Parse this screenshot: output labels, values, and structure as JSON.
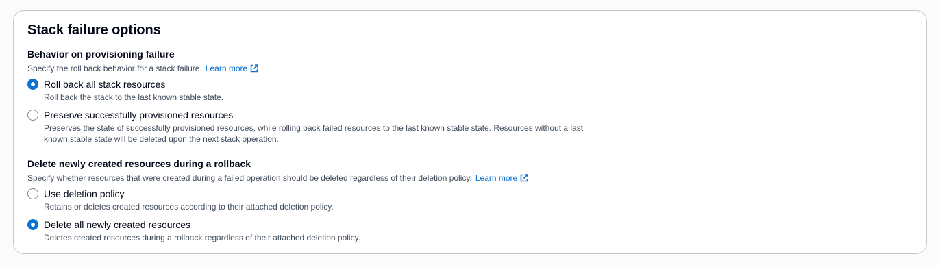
{
  "section": {
    "title": "Stack failure options"
  },
  "provisioning": {
    "label": "Behavior on provisioning failure",
    "description": "Specify the roll back behavior for a stack failure.",
    "learn_more": "Learn more",
    "options": [
      {
        "label": "Roll back all stack resources",
        "description": "Roll back the stack to the last known stable state.",
        "checked": true
      },
      {
        "label": "Preserve successfully provisioned resources",
        "description": "Preserves the state of successfully provisioned resources, while rolling back failed resources to the last known stable state. Resources without a last known stable state will be deleted upon the next stack operation.",
        "checked": false
      }
    ]
  },
  "deletion": {
    "label": "Delete newly created resources during a rollback",
    "description": "Specify whether resources that were created during a failed operation should be deleted regardless of their deletion policy.",
    "learn_more": "Learn more",
    "options": [
      {
        "label": "Use deletion policy",
        "description": "Retains or deletes created resources according to their attached deletion policy.",
        "checked": false
      },
      {
        "label": "Delete all newly created resources",
        "description": "Deletes created resources during a rollback regardless of their attached deletion policy.",
        "checked": true
      }
    ]
  },
  "colors": {
    "accent": "#0972d3",
    "text": "#000716",
    "secondary_text": "#414d5c",
    "border": "#c6c6cd"
  },
  "icons": {
    "external_link": "external-link-icon",
    "radio": "radio-button"
  }
}
